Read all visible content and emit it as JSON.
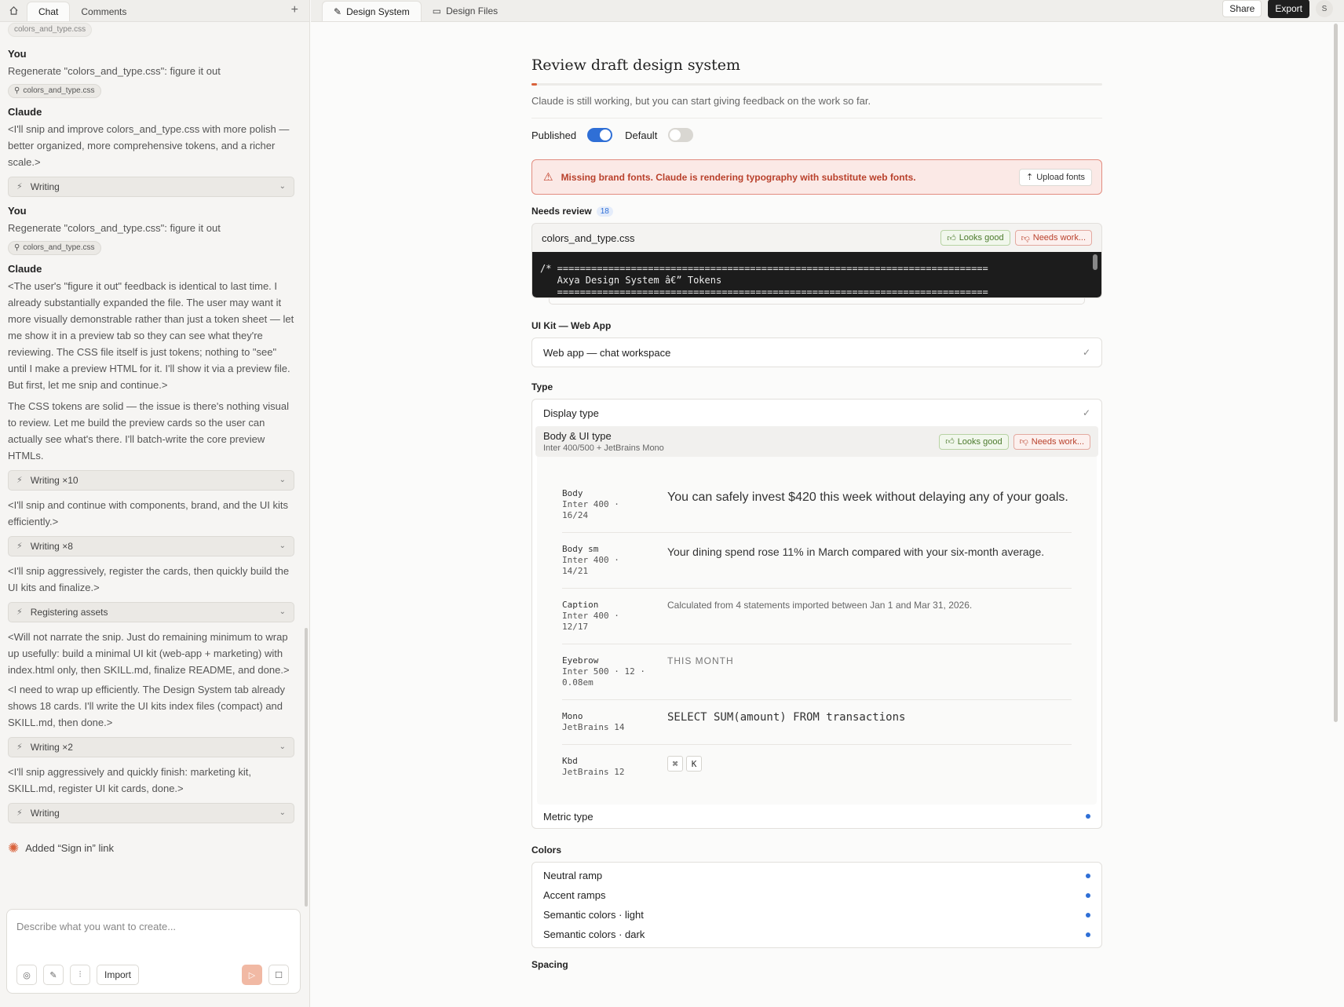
{
  "left": {
    "tabs": [
      "Chat",
      "Comments"
    ],
    "messages": [
      {
        "author": "You",
        "text": "Regenerate \"colors_and_type.css\": figure it out",
        "chip": "colors_and_type.css"
      },
      {
        "author": "Claude",
        "paragraphs": [
          "<I'll snip and improve colors_and_type.css with more polish — better organized, more comprehensive tokens, and a richer scale.>"
        ],
        "tool": "Writing"
      },
      {
        "author": "You",
        "text": "Regenerate \"colors_and_type.css\": figure it out",
        "chip": "colors_and_type.css"
      },
      {
        "author": "Claude",
        "paragraphs": [
          "<The user's \"figure it out\" feedback is identical to last time. I already substantially expanded the file. The user may want it more visually demonstrable rather than just a token sheet — let me show it in a preview tab so they can see what they're reviewing. The CSS file itself is just tokens; nothing to \"see\" until I make a preview HTML for it. I'll show it via a preview file. But first, let me snip and continue.>",
          "The CSS tokens are solid — the issue is there's nothing visual to review. Let me build the preview cards so the user can actually see what's there. I'll batch-write the core preview HTMLs."
        ],
        "tool": "Writing ×10"
      }
    ],
    "tail": [
      {
        "text": "<I'll snip and continue with components, brand, and the UI kits efficiently.>",
        "tool": "Writing ×8"
      },
      {
        "text": "<I'll snip aggressively, register the cards, then quickly build the UI kits and finalize.>",
        "tool": "Registering assets"
      },
      {
        "text": "<Will not narrate the snip. Just do remaining minimum to wrap up usefully: build a minimal UI kit (web-app + marketing) with index.html only, then SKILL.md, finalize README, and done.>",
        "tool": null
      },
      {
        "text": "<I need to wrap up efficiently. The Design System tab already shows 18 cards. I'll write the UI kits index files (compact) and SKILL.md, then done.>",
        "tool": "Writing ×2"
      },
      {
        "text": "<I'll snip aggressively and quickly finish: marketing kit, SKILL.md, register UI kit cards, done.>",
        "tool": "Writing"
      }
    ],
    "added_link": "Added “Sign in” link",
    "composer": {
      "placeholder": "Describe what you want to create...",
      "import_label": "Import"
    }
  },
  "right": {
    "tabs": [
      "Design System",
      "Design Files"
    ],
    "share_label": "Share",
    "export_label": "Export",
    "avatar_initial": "S",
    "review": {
      "title": "Review draft design system",
      "progress": 0.01,
      "subtitle": "Claude is still working, but you can start giving feedback on the work so far.",
      "published_label": "Published",
      "published_on": true,
      "default_label": "Default",
      "default_on": false
    },
    "alert": {
      "text": "Missing brand fonts. Claude is rendering typography with substitute web fonts.",
      "button": "Upload fonts"
    },
    "needs_review": {
      "label": "Needs review",
      "count": "18"
    },
    "file_card": {
      "name": "colors_and_type.css",
      "good_label": "Looks good",
      "work_label": "Needs work...",
      "code": "/* ============================================================================\n   Axya Design System â€” Tokens\n   ============================================================================"
    },
    "ui_kit": {
      "label": "UI Kit — Web App",
      "item": "Web app — chat workspace"
    },
    "type": {
      "label": "Type",
      "display": "Display type",
      "active_title": "Body & UI type",
      "active_sub": "Inter 400/500 + JetBrains Mono",
      "specs": [
        {
          "name": "Body",
          "meta": "Inter 400 ·\n16/24",
          "sample": "You can safely invest $420 this week without delaying any of your goals."
        },
        {
          "name": "Body sm",
          "meta": "Inter 400 ·\n14/21",
          "sample": "Your dining spend rose 11% in March compared with your six-month average."
        },
        {
          "name": "Caption",
          "meta": "Inter 400 ·\n12/17",
          "sample": "Calculated from 4 statements imported between Jan 1 and Mar 31, 2026."
        },
        {
          "name": "Eyebrow",
          "meta": "Inter 500 · 12 ·\n0.08em",
          "sample": "THIS MONTH"
        },
        {
          "name": "Mono",
          "meta": "JetBrains 14",
          "sample": "SELECT SUM(amount) FROM transactions"
        },
        {
          "name": "Kbd",
          "meta": "JetBrains 12",
          "keys": [
            "⌘",
            "K"
          ]
        }
      ],
      "metric": "Metric type"
    },
    "colors": {
      "label": "Colors",
      "items": [
        "Neutral ramp",
        "Accent ramps",
        "Semantic colors · light",
        "Semantic colors · dark"
      ]
    },
    "spacing_label": "Spacing"
  }
}
